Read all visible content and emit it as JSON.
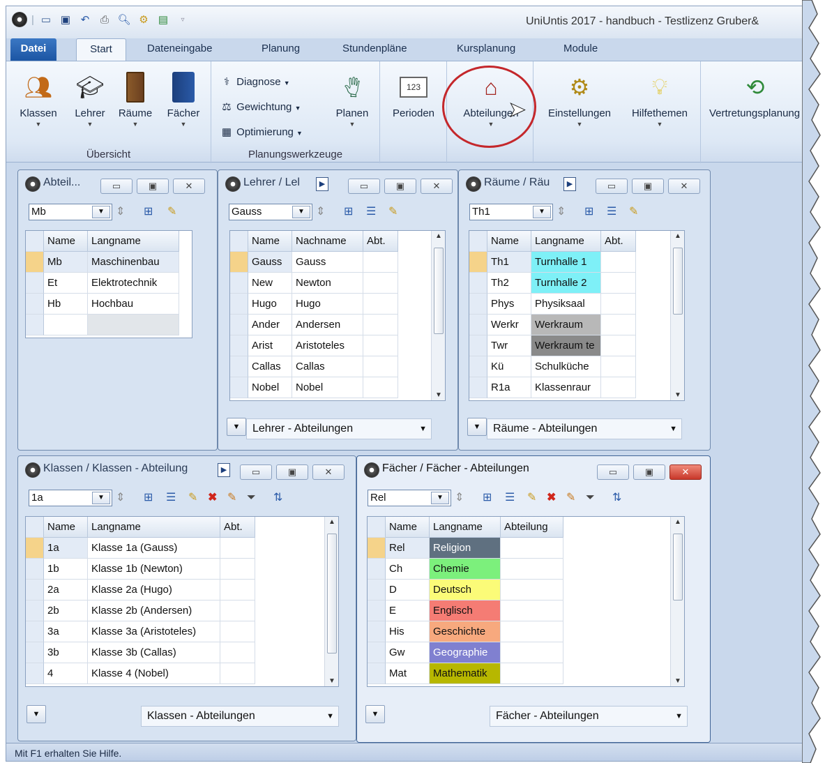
{
  "app": {
    "title": "UniUntis 2017 - handbuch  -  Testlizenz Gruber&",
    "status": "Mit F1 erhalten Sie Hilfe."
  },
  "quick_access": [
    "untis-logo-icon",
    "save-icon",
    "undo-icon",
    "print-icon",
    "print-preview-icon",
    "settings-icon",
    "import-icon"
  ],
  "ribbon_tabs": [
    "Datei",
    "Start",
    "Dateneingabe",
    "Planung",
    "Stundenpläne",
    "Kursplanung",
    "Module"
  ],
  "ribbon": {
    "uebersicht": {
      "label": "Übersicht",
      "buttons": [
        "Klassen",
        "Lehrer",
        "Räume",
        "Fächer"
      ]
    },
    "planungswerkzeuge": {
      "label": "Planungswerkzeuge",
      "items": [
        "Diagnose",
        "Gewichtung",
        "Optimierung"
      ],
      "planen": "Planen"
    },
    "perioden": "Perioden",
    "abteilungen": "Abteilungen",
    "einstellungen": "Einstellungen",
    "hilfethemen": "Hilfethemen",
    "vertretungsplanung": "Vertretungsplanung"
  },
  "windows": {
    "abteil": {
      "title": "Abteil...",
      "combo": "Mb",
      "headers": [
        "Name",
        "Langname"
      ],
      "rows": [
        [
          "Mb",
          "Maschinenbau"
        ],
        [
          "Et",
          "Elektrotechnik"
        ],
        [
          "Hb",
          "Hochbau"
        ],
        [
          "",
          ""
        ]
      ]
    },
    "lehrer": {
      "title": "Lehrer / Lel",
      "combo": "Gauss",
      "headers": [
        "Name",
        "Nachname",
        "Abt."
      ],
      "rows": [
        [
          "Gauss",
          "Gauss",
          ""
        ],
        [
          "New",
          "Newton",
          ""
        ],
        [
          "Hugo",
          "Hugo",
          ""
        ],
        [
          "Ander",
          "Andersen",
          ""
        ],
        [
          "Arist",
          "Aristoteles",
          ""
        ],
        [
          "Callas",
          "Callas",
          ""
        ],
        [
          "Nobel",
          "Nobel",
          ""
        ]
      ],
      "footer": "Lehrer - Abteilungen"
    },
    "raeume": {
      "title": "Räume / Räu",
      "combo": "Th1",
      "headers": [
        "Name",
        "Langname",
        "Abt."
      ],
      "rows": [
        [
          "Th1",
          "Turnhalle 1",
          ""
        ],
        [
          "Th2",
          "Turnhalle 2",
          ""
        ],
        [
          "Phys",
          "Physiksaal",
          ""
        ],
        [
          "Werkr",
          "Werkraum",
          ""
        ],
        [
          "Twr",
          "Werkraum te",
          ""
        ],
        [
          "Kü",
          "Schulküche",
          ""
        ],
        [
          "R1a",
          "Klassenraur",
          ""
        ]
      ],
      "colors": [
        "#7ef0f7",
        "#7ef0f7",
        "#ffffff",
        "#b8b8b8",
        "#8a8a8a",
        "#ffffff",
        "#ffffff"
      ],
      "footer": "Räume - Abteilungen"
    },
    "klassen": {
      "title": "Klassen / Klassen - Abteilung",
      "combo": "1a",
      "headers": [
        "Name",
        "Langname",
        "Abt."
      ],
      "rows": [
        [
          "1a",
          "Klasse 1a (Gauss)",
          ""
        ],
        [
          "1b",
          "Klasse 1b (Newton)",
          ""
        ],
        [
          "2a",
          "Klasse 2a (Hugo)",
          ""
        ],
        [
          "2b",
          "Klasse 2b (Andersen)",
          ""
        ],
        [
          "3a",
          "Klasse 3a (Aristoteles)",
          ""
        ],
        [
          "3b",
          "Klasse 3b (Callas)",
          ""
        ],
        [
          "4",
          "Klasse 4 (Nobel)",
          ""
        ]
      ],
      "footer": "Klassen - Abteilungen"
    },
    "faecher": {
      "title": "Fächer / Fächer - Abteilungen",
      "combo": "Rel",
      "headers": [
        "Name",
        "Langname",
        "Abteilung"
      ],
      "rows": [
        [
          "Rel",
          "Religion",
          ""
        ],
        [
          "Ch",
          "Chemie",
          ""
        ],
        [
          "D",
          "Deutsch",
          ""
        ],
        [
          "E",
          "Englisch",
          ""
        ],
        [
          "His",
          "Geschichte",
          ""
        ],
        [
          "Gw",
          "Geographie",
          ""
        ],
        [
          "Mat",
          "Mathematik",
          ""
        ]
      ],
      "colors": [
        "#5f7080",
        "#7cf07c",
        "#fbfb78",
        "#f57c74",
        "#f7a97e",
        "#8080d0",
        "#b7b700"
      ],
      "text_colors": [
        "#ffffff",
        "#111111",
        "#111111",
        "#111111",
        "#111111",
        "#ffffff",
        "#111111"
      ],
      "footer": "Fächer - Abteilungen"
    }
  },
  "colors": {
    "accent": "#1c55a4",
    "highlight_circle": "#c4272b",
    "current_row": "#f5d38a"
  }
}
